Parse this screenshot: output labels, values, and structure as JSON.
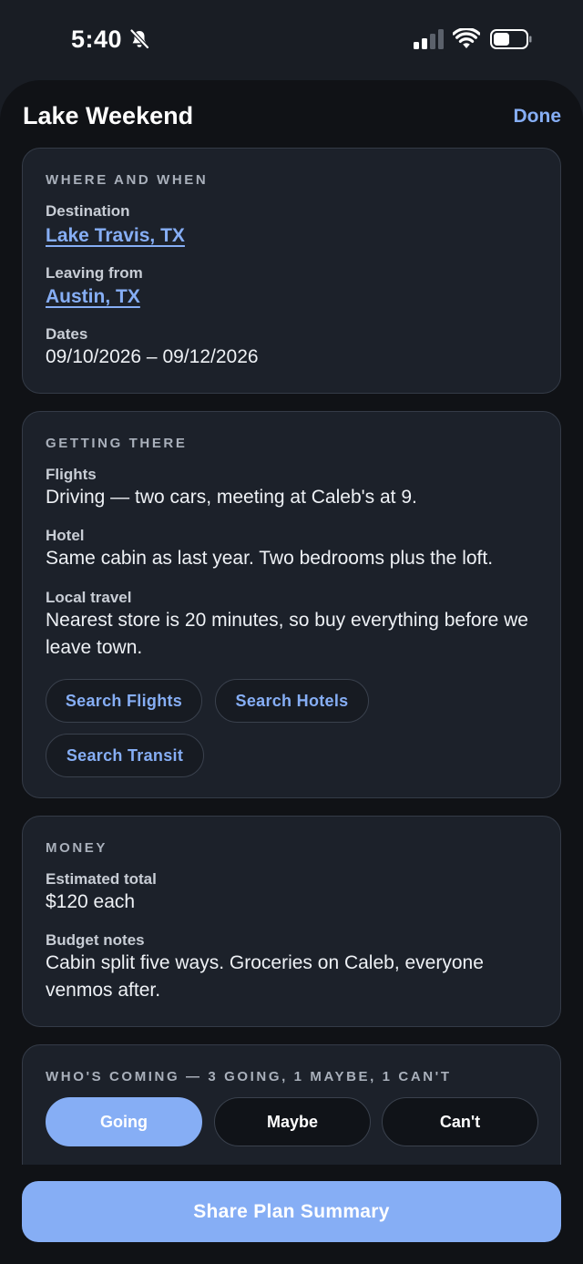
{
  "status_bar": {
    "time": "5:40",
    "icons": [
      "bell-slash-icon",
      "cellular-signal-icon",
      "wifi-icon",
      "battery-icon"
    ]
  },
  "header": {
    "title": "Lake Weekend",
    "done_label": "Done"
  },
  "where_when": {
    "section_title": "WHERE AND WHEN",
    "destination_label": "Destination",
    "destination_value": "Lake Travis, TX",
    "leaving_label": "Leaving from",
    "leaving_value": "Austin, TX",
    "dates_label": "Dates",
    "dates_value": "09/10/2026 – 09/12/2026"
  },
  "getting_there": {
    "section_title": "GETTING THERE",
    "flights_label": "Flights",
    "flights_value": "Driving — two cars, meeting at Caleb's at 9.",
    "hotel_label": "Hotel",
    "hotel_value": "Same cabin as last year. Two bedrooms plus the loft.",
    "local_label": "Local travel",
    "local_value": "Nearest store is 20 minutes, so buy everything before we leave town.",
    "buttons": {
      "flights": "Search Flights",
      "hotels": "Search Hotels",
      "transit": "Search Transit"
    }
  },
  "money": {
    "section_title": "MONEY",
    "total_label": "Estimated total",
    "total_value": "$120 each",
    "notes_label": "Budget notes",
    "notes_value": "Cabin split five ways. Groceries on Caleb, everyone venmos after."
  },
  "whos_coming": {
    "section_title": "WHO'S COMING — 3 GOING, 1 MAYBE, 1 CAN'T",
    "options": [
      "Going",
      "Maybe",
      "Can't"
    ],
    "selected": "Going"
  },
  "bottom": {
    "share_label": "Share Plan Summary"
  },
  "colors": {
    "accent": "#86aef5",
    "card_bg": "#1c212a",
    "sheet_bg": "#101216"
  }
}
